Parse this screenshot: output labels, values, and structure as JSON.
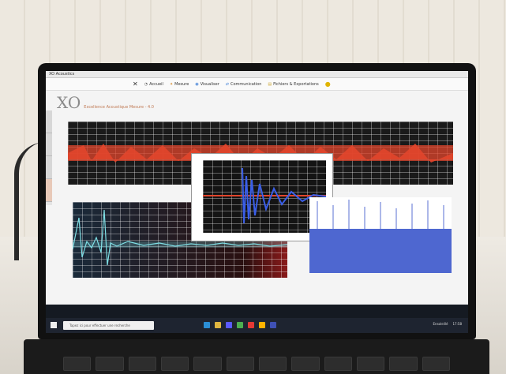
{
  "window": {
    "title": "XO Acoustics",
    "app_title": "XO",
    "app_subtitle": "Excellence Acoustique Mesure - 4.0"
  },
  "menubar": {
    "items": [
      "Accueil",
      "Mesure",
      "Visualiser",
      "Communication",
      "Fichiers & Exportations"
    ]
  },
  "taskbar": {
    "search_placeholder": "Tapez ici pour effectuer une recherche",
    "weather": "Ensoleillé",
    "time": "17:58"
  },
  "colors": {
    "top_signal": "#e2452c",
    "cyan_signal": "#7fe0e6",
    "blue_signal": "#2f4cc8",
    "chart_bg": "#1a1a1a"
  }
}
